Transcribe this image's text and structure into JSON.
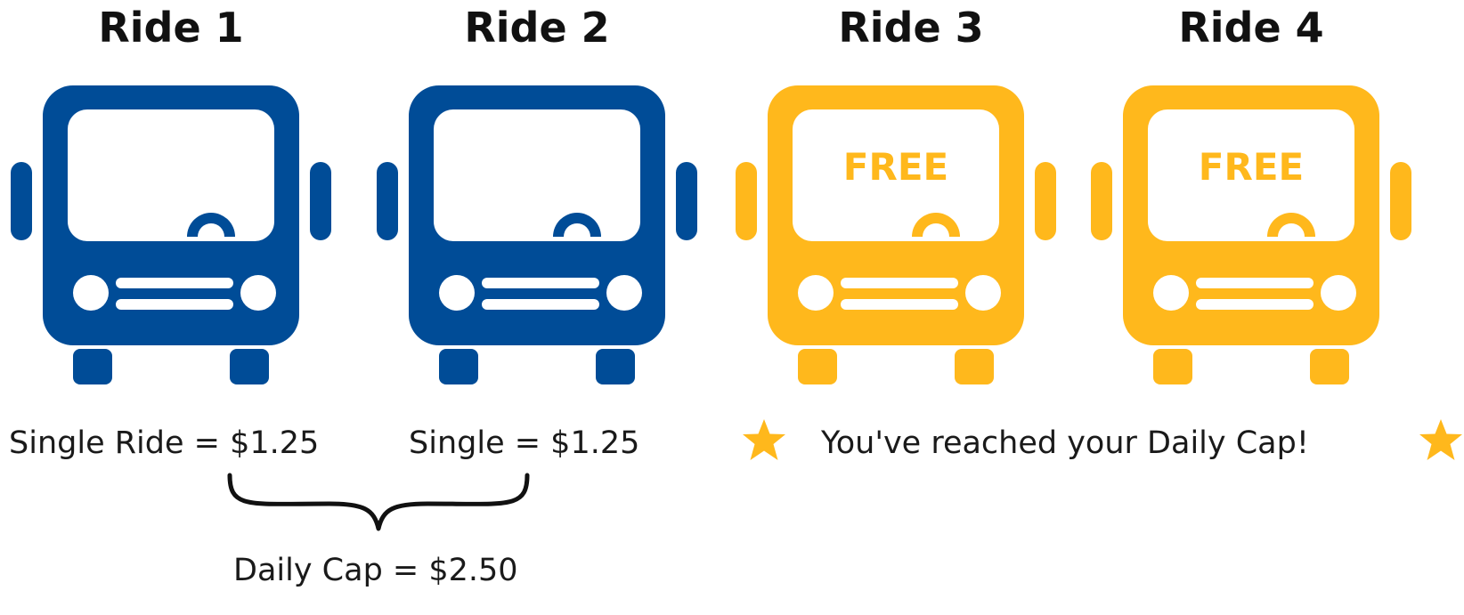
{
  "colors": {
    "paid_bus": "#004C97",
    "free_bus": "#FFB81C",
    "text": "#1a1a1a",
    "star": "#FFB81C"
  },
  "rides": [
    {
      "title": "Ride 1",
      "status": "paid",
      "badge": ""
    },
    {
      "title": "Ride 2",
      "status": "paid",
      "badge": ""
    },
    {
      "title": "Ride 3",
      "status": "free",
      "badge": "FREE"
    },
    {
      "title": "Ride 4",
      "status": "free",
      "badge": "FREE"
    }
  ],
  "captions": {
    "ride1": "Single Ride = $1.25",
    "ride2": "Single = $1.25",
    "daily_cap": "Daily Cap = $2.50",
    "cap_reached": "You've reached your Daily Cap!"
  },
  "icons": {
    "bus": "bus-icon",
    "star": "star-icon",
    "brace": "curly-brace"
  }
}
